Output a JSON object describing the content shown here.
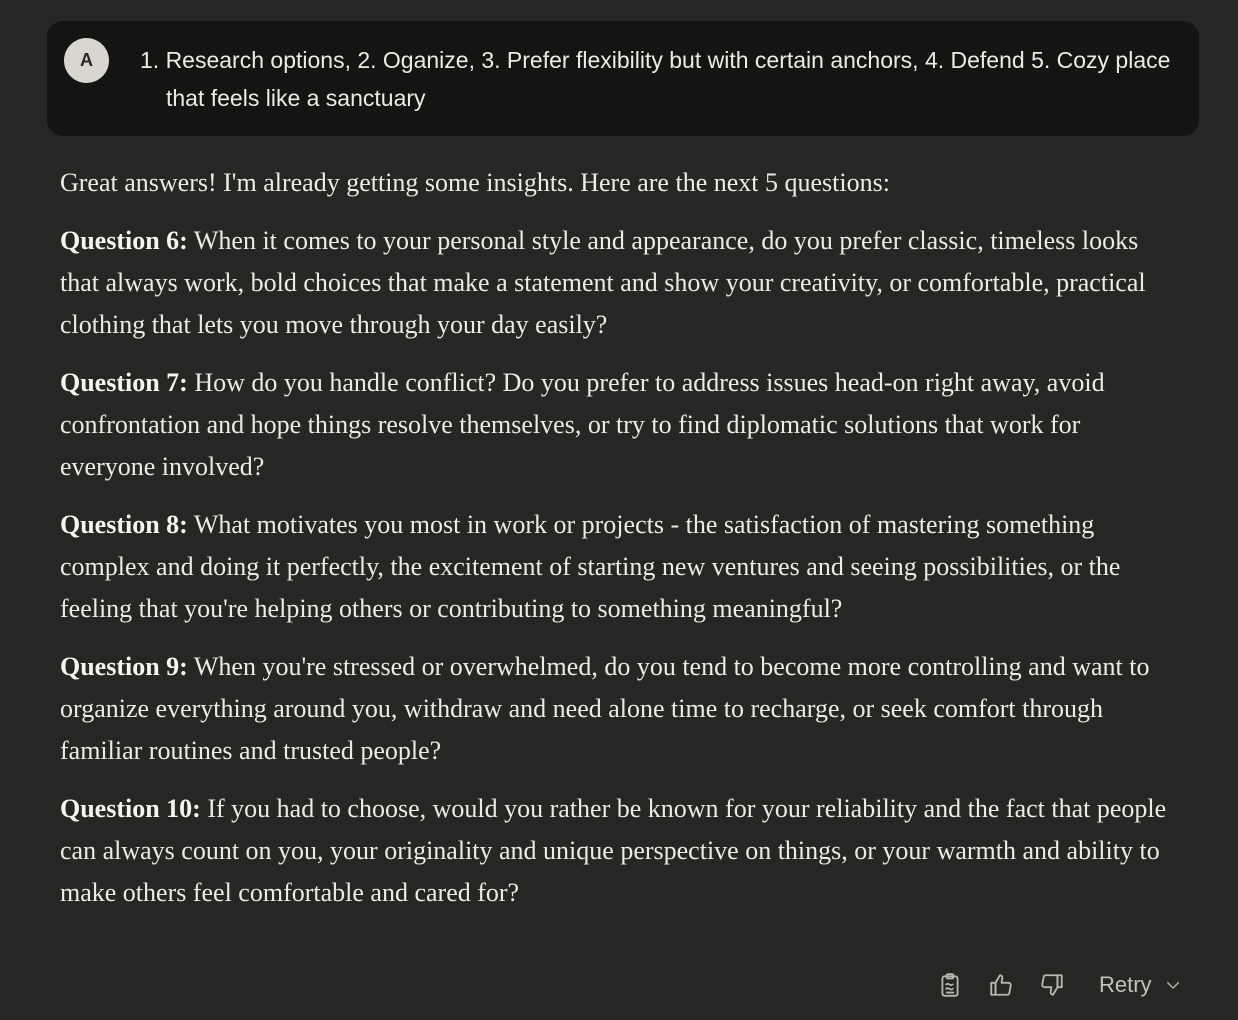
{
  "user_message": {
    "avatar_letter": "A",
    "text": "1. Research options, 2. Oganize, 3. Prefer flexibility but with certain anchors, 4. Defend 5. Cozy place that feels like a sanctuary"
  },
  "response": {
    "intro": "Great answers! I'm already getting some insights. Here are the next 5 questions:",
    "questions": [
      {
        "label": "Question 6:",
        "text": " When it comes to your personal style and appearance, do you prefer classic, timeless looks that always work, bold choices that make a statement and show your creativity, or comfortable, practical clothing that lets you move through your day easily?"
      },
      {
        "label": "Question 7:",
        "text": " How do you handle conflict? Do you prefer to address issues head-on right away, avoid confrontation and hope things resolve themselves, or try to find diplomatic solutions that work for everyone involved?"
      },
      {
        "label": "Question 8:",
        "text": " What motivates you most in work or projects - the satisfaction of mastering something complex and doing it perfectly, the excitement of starting new ventures and seeing possibilities, or the feeling that you're helping others or contributing to something meaningful?"
      },
      {
        "label": "Question 9:",
        "text": " When you're stressed or overwhelmed, do you tend to become more controlling and want to organize everything around you, withdraw and need alone time to recharge, or seek comfort through familiar routines and trusted people?"
      },
      {
        "label": "Question 10:",
        "text": " If you had to choose, would you rather be known for your reliability and the fact that people can always count on you, your originality and unique perspective on things, or your warmth and ability to make others feel comfortable and cared for?"
      }
    ]
  },
  "actions": {
    "copy_icon": "clipboard-icon",
    "thumbs_up_icon": "thumbs-up-icon",
    "thumbs_down_icon": "thumbs-down-icon",
    "retry_label": "Retry",
    "retry_chevron_icon": "chevron-down-icon"
  },
  "colors": {
    "background": "#262624",
    "user_bubble": "#141413",
    "avatar": "#d8d6cf",
    "text": "#ecebe7",
    "icon": "#b8b6ae"
  }
}
